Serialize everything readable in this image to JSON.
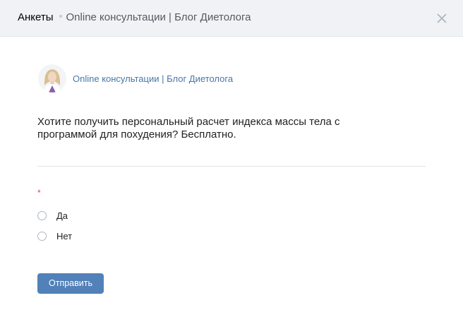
{
  "header": {
    "breadcrumb_root": "Анкеты",
    "breadcrumb_current": "Online консультации | Блог Диетолога",
    "close_icon": "close-icon"
  },
  "author": {
    "name": "Online консультации | Блог Диетолога",
    "avatar_icon": "avatar-icon"
  },
  "form": {
    "question": "Хотите получить персональный расчет индекса массы тела с программой для похудения? Бесплатно.",
    "required_mark": "*",
    "options": [
      {
        "label": "Да",
        "selected": false
      },
      {
        "label": "Нет",
        "selected": false
      }
    ],
    "submit_label": "Отправить"
  },
  "colors": {
    "header_bg": "#f0f2f5",
    "link": "#4a76a8",
    "button": "#5181b8",
    "required": "#e64646"
  }
}
